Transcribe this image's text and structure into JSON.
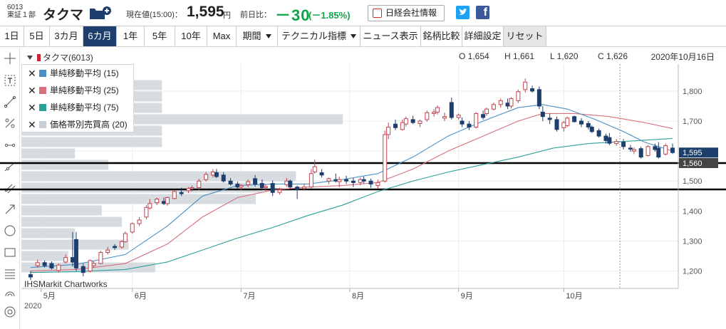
{
  "header": {
    "code": "6013",
    "market": "東証１部",
    "name": "タクマ",
    "price_label": "現在値(15:00)：",
    "price": "1,595",
    "price_unit": "円",
    "change_label": "前日比：",
    "change": "－30",
    "change_pct": "(－1.85%)",
    "nikkei_button": "日経会社情報",
    "twitter_icon": "twitter-icon",
    "facebook_icon": "facebook-icon",
    "facebook_glyph": "f"
  },
  "toolbar": {
    "periods": [
      "1日",
      "5日",
      "3カ月",
      "6カ月",
      "1年",
      "5年",
      "10年",
      "Max"
    ],
    "active": "6カ月",
    "menus": [
      "期間",
      "テクニカル指標"
    ],
    "buttons": [
      "ニュース表示",
      "銘柄比較",
      "詳細設定",
      "リセット"
    ]
  },
  "chart_header": {
    "title": "タクマ(6013)",
    "open": "O 1,654",
    "high": "H 1,661",
    "low": "L 1,620",
    "close": "C 1,626",
    "date": "2020年10月16日"
  },
  "legend": [
    {
      "label": "単純移動平均 (15)",
      "color": "#4a90c2"
    },
    {
      "label": "単純移動平均 (25)",
      "color": "#d9707e"
    },
    {
      "label": "単純移動平均 (75)",
      "color": "#2aa198"
    },
    {
      "label": "価格帯別売買高 (20)",
      "color": "#c8cfd6"
    }
  ],
  "attribution": "IHSMarkit Chartworks",
  "year_label": "2020",
  "chart_data": {
    "type": "candlestick",
    "y_ticks": [
      "1,800",
      "1,700",
      "1,600",
      "1,500",
      "1,400",
      "1,300",
      "1,200"
    ],
    "y_values": [
      1800,
      1700,
      1600,
      1500,
      1400,
      1300,
      1200
    ],
    "ylim": [
      1142,
      1890
    ],
    "x_labels": [
      "5月",
      "6月",
      "7月",
      "8月",
      "9月",
      "10月"
    ],
    "x_label_day": [
      4,
      30,
      61,
      92,
      123,
      153
    ],
    "x_days": [
      0,
      184
    ],
    "last_price": {
      "label": "1,595",
      "value": 1595,
      "color": "#1d3f6e"
    },
    "hline_price": {
      "label": "1,560",
      "value": 1560
    },
    "hlines": [
      1560,
      1472
    ],
    "cursor_day": 169,
    "candles": [
      [
        1,
        1188,
        1200,
        1170,
        1180
      ],
      [
        3,
        1218,
        1238,
        1210,
        1228
      ],
      [
        5,
        1228,
        1235,
        1212,
        1218
      ],
      [
        7,
        1225,
        1232,
        1205,
        1210
      ],
      [
        9,
        1202,
        1225,
        1195,
        1220
      ],
      [
        11,
        1230,
        1255,
        1225,
        1245
      ],
      [
        13,
        1245,
        1330,
        1215,
        1230
      ],
      [
        14,
        1305,
        1330,
        1200,
        1210
      ],
      [
        16,
        1215,
        1225,
        1182,
        1195
      ],
      [
        18,
        1200,
        1238,
        1195,
        1235
      ],
      [
        19,
        1218,
        1232,
        1210,
        1225
      ],
      [
        21,
        1225,
        1268,
        1222,
        1262
      ],
      [
        23,
        1262,
        1280,
        1255,
        1270
      ],
      [
        25,
        1282,
        1290,
        1270,
        1278
      ],
      [
        27,
        1280,
        1302,
        1275,
        1298
      ],
      [
        28,
        1298,
        1332,
        1295,
        1325
      ],
      [
        30,
        1330,
        1362,
        1325,
        1358
      ],
      [
        32,
        1358,
        1380,
        1350,
        1370
      ],
      [
        34,
        1380,
        1420,
        1372,
        1412
      ],
      [
        35,
        1410,
        1440,
        1405,
        1425
      ],
      [
        37,
        1428,
        1445,
        1420,
        1440
      ],
      [
        39,
        1432,
        1445,
        1420,
        1425
      ],
      [
        40,
        1425,
        1448,
        1418,
        1445
      ],
      [
        42,
        1442,
        1470,
        1438,
        1465
      ],
      [
        44,
        1462,
        1478,
        1450,
        1458
      ],
      [
        46,
        1468,
        1480,
        1460,
        1475
      ],
      [
        47,
        1475,
        1485,
        1465,
        1478
      ],
      [
        49,
        1478,
        1508,
        1470,
        1500
      ],
      [
        51,
        1505,
        1530,
        1498,
        1522
      ],
      [
        53,
        1520,
        1540,
        1512,
        1530
      ],
      [
        54,
        1528,
        1540,
        1510,
        1515
      ],
      [
        56,
        1520,
        1530,
        1495,
        1500
      ],
      [
        58,
        1500,
        1510,
        1485,
        1490
      ],
      [
        60,
        1490,
        1498,
        1475,
        1480
      ],
      [
        61,
        1480,
        1490,
        1470,
        1485
      ],
      [
        63,
        1488,
        1505,
        1480,
        1498
      ],
      [
        65,
        1508,
        1520,
        1482,
        1490
      ],
      [
        67,
        1492,
        1505,
        1470,
        1478
      ],
      [
        68,
        1478,
        1490,
        1465,
        1482
      ],
      [
        70,
        1492,
        1502,
        1450,
        1462
      ],
      [
        72,
        1462,
        1478,
        1455,
        1470
      ],
      [
        74,
        1488,
        1510,
        1480,
        1500
      ],
      [
        75,
        1500,
        1505,
        1475,
        1480
      ],
      [
        77,
        1480,
        1485,
        1440,
        1472
      ],
      [
        79,
        1475,
        1492,
        1468,
        1480
      ],
      [
        81,
        1480,
        1540,
        1475,
        1525
      ],
      [
        82,
        1530,
        1572,
        1525,
        1548
      ],
      [
        84,
        1528,
        1540,
        1512,
        1520
      ],
      [
        86,
        1500,
        1512,
        1490,
        1508
      ],
      [
        88,
        1505,
        1525,
        1495,
        1500
      ],
      [
        89,
        1498,
        1515,
        1480,
        1505
      ],
      [
        91,
        1505,
        1518,
        1490,
        1500
      ],
      [
        93,
        1500,
        1510,
        1480,
        1495
      ],
      [
        95,
        1495,
        1512,
        1485,
        1505
      ],
      [
        96,
        1505,
        1515,
        1492,
        1500
      ],
      [
        98,
        1500,
        1508,
        1478,
        1490
      ],
      [
        100,
        1485,
        1505,
        1475,
        1495
      ],
      [
        102,
        1500,
        1668,
        1495,
        1655
      ],
      [
        103,
        1655,
        1695,
        1640,
        1680
      ],
      [
        105,
        1690,
        1705,
        1670,
        1678
      ],
      [
        107,
        1672,
        1705,
        1668,
        1695
      ],
      [
        108,
        1690,
        1715,
        1682,
        1708
      ],
      [
        110,
        1705,
        1718,
        1690,
        1695
      ],
      [
        112,
        1692,
        1705,
        1680,
        1700
      ],
      [
        114,
        1705,
        1735,
        1698,
        1728
      ],
      [
        116,
        1725,
        1740,
        1715,
        1730
      ],
      [
        117,
        1730,
        1752,
        1722,
        1745
      ],
      [
        119,
        1710,
        1728,
        1700,
        1715
      ],
      [
        121,
        1762,
        1778,
        1705,
        1712
      ],
      [
        123,
        1712,
        1725,
        1705,
        1720
      ],
      [
        124,
        1700,
        1712,
        1680,
        1690
      ],
      [
        126,
        1690,
        1700,
        1670,
        1680
      ],
      [
        128,
        1680,
        1730,
        1675,
        1725
      ],
      [
        130,
        1722,
        1735,
        1705,
        1712
      ],
      [
        131,
        1725,
        1745,
        1718,
        1740
      ],
      [
        133,
        1740,
        1762,
        1735,
        1755
      ],
      [
        135,
        1755,
        1775,
        1745,
        1768
      ],
      [
        137,
        1760,
        1775,
        1740,
        1750
      ],
      [
        138,
        1750,
        1780,
        1742,
        1775
      ],
      [
        140,
        1768,
        1805,
        1760,
        1798
      ],
      [
        142,
        1805,
        1842,
        1795,
        1830
      ],
      [
        144,
        1808,
        1818,
        1795,
        1800
      ],
      [
        146,
        1805,
        1815,
        1740,
        1750
      ],
      [
        147,
        1730,
        1750,
        1700,
        1715
      ],
      [
        149,
        1710,
        1725,
        1690,
        1705
      ],
      [
        151,
        1705,
        1715,
        1665,
        1672
      ],
      [
        153,
        1678,
        1700,
        1665,
        1695
      ],
      [
        154,
        1685,
        1715,
        1680,
        1710
      ],
      [
        156,
        1715,
        1718,
        1695,
        1698
      ],
      [
        158,
        1700,
        1710,
        1680,
        1690
      ],
      [
        160,
        1692,
        1700,
        1672,
        1680
      ],
      [
        161,
        1680,
        1685,
        1660,
        1665
      ],
      [
        163,
        1668,
        1675,
        1645,
        1650
      ],
      [
        165,
        1650,
        1658,
        1625,
        1635
      ],
      [
        166,
        1645,
        1660,
        1620,
        1626
      ],
      [
        168,
        1625,
        1640,
        1618,
        1632
      ],
      [
        170,
        1630,
        1640,
        1605,
        1615
      ],
      [
        172,
        1610,
        1620,
        1598,
        1608
      ],
      [
        173,
        1600,
        1612,
        1590,
        1605
      ],
      [
        175,
        1608,
        1615,
        1575,
        1580
      ],
      [
        177,
        1585,
        1620,
        1582,
        1615
      ],
      [
        179,
        1615,
        1625,
        1598,
        1605
      ],
      [
        180,
        1610,
        1630,
        1575,
        1580
      ],
      [
        182,
        1590,
        1625,
        1585,
        1618
      ],
      [
        184,
        1610,
        1625,
        1590,
        1595
      ]
    ],
    "ma15": [
      [
        1,
        1212
      ],
      [
        14,
        1222
      ],
      [
        28,
        1255
      ],
      [
        40,
        1350
      ],
      [
        50,
        1450
      ],
      [
        60,
        1485
      ],
      [
        70,
        1490
      ],
      [
        80,
        1490
      ],
      [
        90,
        1505
      ],
      [
        100,
        1525
      ],
      [
        110,
        1580
      ],
      [
        120,
        1650
      ],
      [
        130,
        1700
      ],
      [
        140,
        1745
      ],
      [
        147,
        1755
      ],
      [
        154,
        1740
      ],
      [
        162,
        1705
      ],
      [
        170,
        1665
      ],
      [
        176,
        1630
      ],
      [
        184,
        1600
      ]
    ],
    "ma25": [
      [
        1,
        1200
      ],
      [
        14,
        1205
      ],
      [
        28,
        1225
      ],
      [
        40,
        1290
      ],
      [
        50,
        1380
      ],
      [
        60,
        1445
      ],
      [
        70,
        1470
      ],
      [
        80,
        1480
      ],
      [
        90,
        1485
      ],
      [
        100,
        1495
      ],
      [
        110,
        1540
      ],
      [
        120,
        1600
      ],
      [
        130,
        1650
      ],
      [
        140,
        1700
      ],
      [
        147,
        1725
      ],
      [
        156,
        1725
      ],
      [
        166,
        1715
      ],
      [
        176,
        1695
      ],
      [
        184,
        1675
      ]
    ],
    "ma75": [
      [
        1,
        1195
      ],
      [
        14,
        1198
      ],
      [
        28,
        1205
      ],
      [
        40,
        1230
      ],
      [
        50,
        1270
      ],
      [
        60,
        1310
      ],
      [
        70,
        1345
      ],
      [
        80,
        1385
      ],
      [
        90,
        1420
      ],
      [
        100,
        1465
      ],
      [
        110,
        1500
      ],
      [
        120,
        1530
      ],
      [
        130,
        1555
      ],
      [
        140,
        1580
      ],
      [
        150,
        1610
      ],
      [
        160,
        1625
      ],
      [
        170,
        1632
      ],
      [
        184,
        1642
      ]
    ],
    "volume_profile": [
      [
        1820,
        5
      ],
      [
        1782,
        5
      ],
      [
        1744,
        5
      ],
      [
        1706,
        5
      ],
      [
        1668,
        5
      ],
      [
        1630,
        5
      ],
      [
        1592,
        5
      ],
      [
        1554,
        5
      ],
      [
        1516,
        5
      ],
      [
        1478,
        5
      ],
      [
        1440,
        5
      ],
      [
        1402,
        5
      ],
      [
        1364,
        5
      ],
      [
        1326,
        5
      ],
      [
        1288,
        5
      ],
      [
        1250,
        5
      ],
      [
        1212,
        5
      ]
    ]
  }
}
